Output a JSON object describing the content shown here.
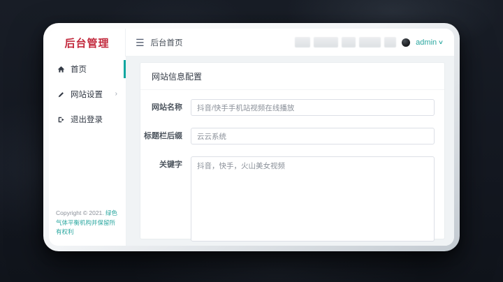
{
  "window": {
    "logo": "后台管理",
    "header": {
      "breadcrumb": "后台首页",
      "user": "admin"
    }
  },
  "icons": {
    "hamburger": "☰",
    "chevron_right": "›",
    "caret_down": "∨"
  },
  "sidebar": {
    "items": [
      {
        "label": "首页",
        "icon": "home-icon",
        "active": true
      },
      {
        "label": "网站设置",
        "icon": "pencil-icon",
        "has_submenu": true
      },
      {
        "label": "退出登录",
        "icon": "logout-icon"
      }
    ],
    "copyright_prefix": "Copyright © 2021.",
    "copyright_link": "绿色气体平衡机构并保留所有权利"
  },
  "main": {
    "card_title": "网站信息配置",
    "form": {
      "fields": [
        {
          "label": "网站名称",
          "value": "抖音/快手手机站视频在线播放",
          "type": "input"
        },
        {
          "label": "标题栏后缀",
          "value": "云云系统",
          "type": "input"
        },
        {
          "label": "关键字",
          "value": "抖音，快手，火山美女视频",
          "type": "textarea"
        }
      ]
    }
  },
  "colors": {
    "accent_teal": "#10a7a0",
    "logo_red": "#c2283c",
    "content_bg": "#f0f3f5",
    "frame_bg": "#e8ebee",
    "backdrop": "#161b22"
  }
}
